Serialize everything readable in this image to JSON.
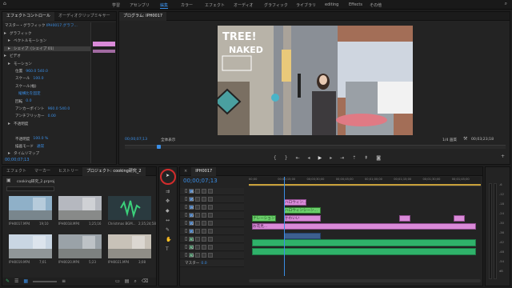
{
  "menu": {
    "items": [
      "学習",
      "アセンブリ",
      "編集",
      "カラー",
      "エフェクト",
      "オーディオ",
      "グラフィック",
      "ライブラリ",
      "editing",
      "Effects",
      "その他"
    ],
    "active_index": 2
  },
  "effect_controls": {
    "tabs": [
      "エフェクトコントロール",
      "オーディオクリップミキサー"
    ],
    "source": "マスター・グラフィック",
    "clip_name": "IPH0017.グラフ...",
    "sections": [
      {
        "label": "グラフィック",
        "indent": 0
      },
      {
        "label": "ベクトルモーション",
        "indent": 1
      },
      {
        "label": "シェイプ（シェイプ 01）",
        "indent": 1,
        "selected": true
      },
      {
        "label": "ビデオ",
        "indent": 0
      },
      {
        "label": "モーション",
        "indent": 1
      },
      {
        "label": "位置",
        "value": "960.0  540.0",
        "indent": 2
      },
      {
        "label": "スケール",
        "value": "100.0",
        "indent": 2
      },
      {
        "label": "スケール(幅)",
        "value": "",
        "indent": 2
      },
      {
        "label": "",
        "value": "縦横比を固定",
        "indent": 2
      },
      {
        "label": "回転",
        "value": "0.0",
        "indent": 2
      },
      {
        "label": "アンカーポイント",
        "value": "960.0  540.0",
        "indent": 2
      },
      {
        "label": "アンチフリッカー",
        "value": "0.00",
        "indent": 2
      },
      {
        "label": "不透明度",
        "indent": 1
      },
      {
        "label": "",
        "value": "",
        "indent": 2
      },
      {
        "label": "不透明度",
        "value": "100.0 %",
        "indent": 2
      },
      {
        "label": "描画モード",
        "value": "通常",
        "indent": 2
      },
      {
        "label": "タイムリマップ",
        "indent": 1
      }
    ],
    "timecode": "00;00;07;13"
  },
  "program_monitor": {
    "title": "プログラム: IPH0017",
    "timecode": "00;00;07;13",
    "fit": "全体表示",
    "quality": "1/4 画質",
    "duration": "00;03;23;18"
  },
  "project": {
    "tabs": [
      "エフェクト",
      "マーカー",
      "ヒストリー",
      "プロジェクト: cooking研究_2"
    ],
    "bin_name": "cooking研究_2.prproj",
    "items": [
      {
        "name": "IPH0017.MP4",
        "duration": "19;10"
      },
      {
        "name": "IPH0018.MP4",
        "duration": "1;25;16"
      },
      {
        "name": "Christmas BGM...",
        "duration": "2;35;24;58"
      },
      {
        "name": "IPH0019.MP4",
        "duration": "7;01"
      },
      {
        "name": "IPH0020.MP4",
        "duration": "5;23"
      },
      {
        "name": "IPH0021.MP4",
        "duration": "3;08"
      }
    ]
  },
  "timeline": {
    "tab": "IPH0017",
    "timecode": "00;00;07;13",
    "ruler": [
      "00;00",
      "00;00;15;00",
      "00;00;30;00",
      "00;00;45;00",
      "00;01;00;00",
      "00;01;15;00",
      "00;01;30;00",
      "00;01;45;00"
    ],
    "video_tracks": [
      "V6",
      "V5",
      "V4",
      "V3",
      "V2",
      "V1"
    ],
    "audio_tracks": [
      "A1",
      "A2",
      "A3"
    ],
    "master": "マスター",
    "master_value": "0.0",
    "clip_labels": [
      "ハロウィン...",
      "ハロウィンシーン...",
      "ナレーション",
      "かわいい",
      "お花見..."
    ],
    "meter_labels": [
      "-6",
      "-12",
      "-18",
      "-24",
      "-30",
      "-36",
      "-42",
      "-48",
      "-54",
      "dB"
    ]
  },
  "colors": {
    "accent": "#3a8ee6",
    "pink": "#d98ad8",
    "green": "#2fb26a",
    "highlight_circle": "#d22c2c"
  }
}
